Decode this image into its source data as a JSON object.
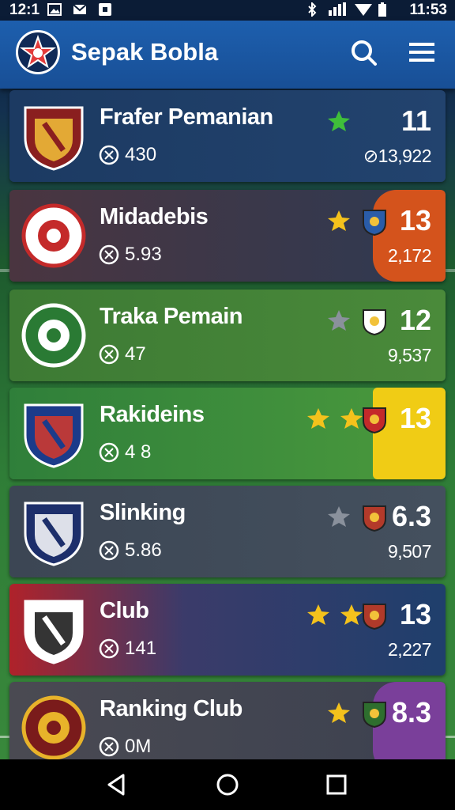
{
  "status_bar": {
    "time": "12:1",
    "right_time": "11:53",
    "icons": [
      "image-icon",
      "mail-icon",
      "app-icon",
      "bluetooth-icon",
      "signal-icon",
      "wifi-icon",
      "battery-icon"
    ]
  },
  "app_bar": {
    "title": "Sepak Bobla",
    "icons": [
      "search-icon",
      "menu-icon"
    ]
  },
  "rows": [
    {
      "name": "Frafer Pemanian",
      "stat": "430",
      "score": "11",
      "sub": "⊘13,922",
      "stars": [
        "filled-green"
      ],
      "accent": ""
    },
    {
      "name": "Midadebis",
      "stat": "5.93",
      "score": "13",
      "sub": "2,172",
      "stars": [
        "filled"
      ],
      "accent": "#d4531c"
    },
    {
      "name": "Traka Pemain",
      "stat": "47",
      "score": "12",
      "sub": "9,537",
      "stars": [
        "empty"
      ],
      "accent": ""
    },
    {
      "name": "Rakideins",
      "stat": "4 8",
      "score": "13",
      "sub": "",
      "stars": [
        "filled",
        "filled"
      ],
      "accent": "#f0cc15"
    },
    {
      "name": "Slinking",
      "stat": "5.86",
      "score": "6.3",
      "sub": "9,507",
      "stars": [
        "empty"
      ],
      "accent": ""
    },
    {
      "name": "Club",
      "stat": "141",
      "score": "13",
      "sub": "2,227",
      "stars": [
        "filled",
        "filled"
      ],
      "accent": ""
    },
    {
      "name": "Ranking Club",
      "stat": "0M",
      "score": "8.3",
      "sub": "",
      "stars": [
        "filled"
      ],
      "accent": "#7a3f9a"
    }
  ],
  "nav": [
    "back-icon",
    "home-icon",
    "recents-icon"
  ]
}
